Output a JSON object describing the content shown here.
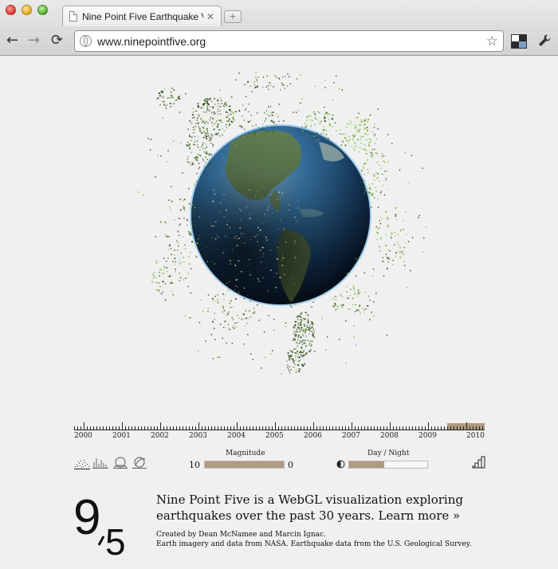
{
  "browser": {
    "tab_title": "Nine Point Five Earthquake V",
    "tab_close": "✕",
    "new_tab": "+",
    "url": "www.ninepointfive.org",
    "back_label": "←",
    "forward_label": "→",
    "reload_label": "⟳",
    "star_label": "☆",
    "wrench_label": "🔧",
    "icons": [
      "back-icon",
      "forward-icon",
      "reload-icon",
      "globe-icon",
      "star-icon",
      "extension-icon",
      "wrench-icon"
    ]
  },
  "timeline": {
    "years": [
      "2000",
      "2001",
      "2002",
      "2003",
      "2004",
      "2005",
      "2006",
      "2007",
      "2008",
      "2009",
      "2010"
    ],
    "selected_year": "2010",
    "highlight_color": "#b09a80"
  },
  "controls": {
    "view_modes": [
      {
        "icon": "scatter-dots-icon",
        "active": true
      },
      {
        "icon": "bar-spikes-icon",
        "active": false
      },
      {
        "icon": "globe-rings-icon",
        "active": false
      },
      {
        "icon": "globe-arc-icon",
        "active": false
      }
    ],
    "magnitude": {
      "label": "Magnitude",
      "min_label": "10",
      "max_label": "0",
      "fill_fraction": 1.0
    },
    "day_night": {
      "label": "Day / Night",
      "icon": "half-moon-icon",
      "fill_fraction": 0.45
    },
    "stairs_icon": "stairs-icon",
    "slider_color": "#b09a80"
  },
  "footer": {
    "logo_text": "9,5",
    "description": "Nine Point Five is a WebGL visualization exploring earthquakes over the past 30 years. Learn more »",
    "credit_line1": "Created by Dean McNamee and Marcin Ignac.",
    "credit_line2": "Earth imagery and data from NASA. Earthquake data from the U.S. Geological Survey."
  },
  "colors": {
    "page_background": "#f0f0f0",
    "quake_dark": "#2f4a12",
    "quake_light": "#7ab83a",
    "ocean_light": "#5a9acc",
    "ocean_dark": "#0d1f33"
  }
}
